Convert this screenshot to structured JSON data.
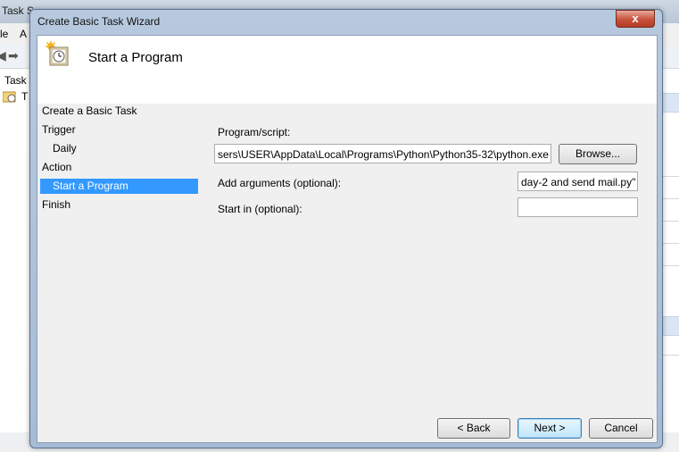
{
  "background_app": {
    "title_fragment": "Task S",
    "menu": [
      "le",
      "A"
    ],
    "tree_items": [
      "Task",
      "T"
    ]
  },
  "dialog": {
    "title": "Create Basic Task Wizard",
    "close_glyph": "x",
    "header_title": "Start a Program"
  },
  "nav": {
    "items": [
      {
        "label": "Create a Basic Task"
      },
      {
        "label": "Trigger"
      },
      {
        "label": "Daily"
      },
      {
        "label": "Action"
      },
      {
        "label": "Start a Program"
      },
      {
        "label": "Finish"
      }
    ]
  },
  "form": {
    "program_label": "Program/script:",
    "program_value": "sers\\USER\\AppData\\Local\\Programs\\Python\\Python35-32\\python.exe",
    "browse_label": "Browse...",
    "args_label": "Add arguments (optional):",
    "args_value": "day-2 and send mail.py\"",
    "start_in_label": "Start in (optional):",
    "start_in_value": ""
  },
  "buttons": {
    "back": "< Back",
    "next": "Next >",
    "cancel": "Cancel"
  },
  "colors": {
    "selection": "#3399ff",
    "dialog_frame": "#a6bcd6"
  }
}
